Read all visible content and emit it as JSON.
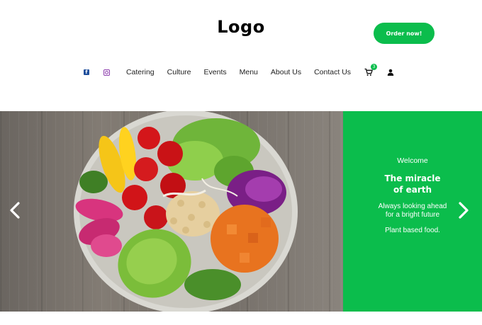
{
  "header": {
    "logo": "Logo",
    "order_button": "Order now!"
  },
  "nav": {
    "icons": [
      "facebook-icon",
      "instagram-icon"
    ],
    "items": [
      "Catering",
      "Culture",
      "Events",
      "Menu",
      "About Us",
      "Contact Us"
    ],
    "cart_count": "3"
  },
  "hero": {
    "welcome": "Welcome",
    "headline_line1": "The miracle",
    "headline_line2": "of earth",
    "subtitle_line1": "Always looking ahead",
    "subtitle_line2": "for a bright future",
    "tagline": "Plant based food."
  },
  "colors": {
    "brand_green": "#0bbd4c",
    "text_dark": "#222222"
  }
}
